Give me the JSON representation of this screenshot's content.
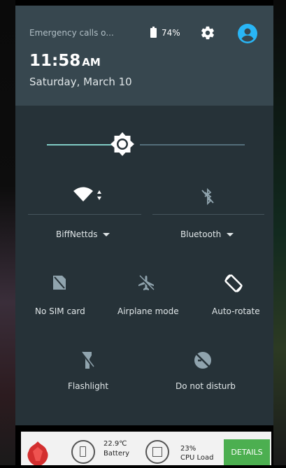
{
  "status": {
    "carrier_text": "Emergency calls o...",
    "battery_percent": "74%",
    "battery_icon": "battery-icon",
    "settings_icon": "gear-icon",
    "user_icon": "account-icon"
  },
  "clock": {
    "time": "11:58",
    "ampm": "AM",
    "date": "Saturday, March 10"
  },
  "brightness": {
    "level": 0.36,
    "icon": "brightness-icon"
  },
  "tiles_top": [
    {
      "label": "BiffNettds",
      "icon": "wifi-icon"
    },
    {
      "label": "Bluetooth",
      "icon": "bluetooth-off-icon"
    }
  ],
  "tiles": [
    {
      "label": "No SIM card",
      "icon": "no-sim-icon"
    },
    {
      "label": "Airplane mode",
      "icon": "airplane-icon"
    },
    {
      "label": "Auto-rotate",
      "icon": "auto-rotate-icon"
    },
    {
      "label": "Flashlight",
      "icon": "flashlight-off-icon"
    },
    {
      "label": "Do not disturb",
      "icon": "do-not-disturb-icon"
    }
  ],
  "notification": {
    "battery_temp": "22.9℃",
    "battery_label": "Battery",
    "cpu_value": "23%",
    "cpu_label": "CPU Load",
    "details_button": "DETAILS"
  },
  "colors": {
    "header": "#37474f",
    "panel": "#263238",
    "accent": "#80cbc4",
    "details": "#4caf50"
  }
}
